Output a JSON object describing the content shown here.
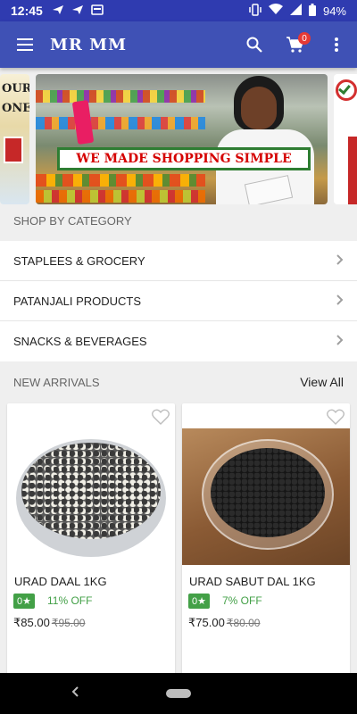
{
  "status_bar": {
    "time": "12:45",
    "battery": "94%",
    "icons": [
      "send-icon",
      "send-icon",
      "media-icon",
      "vibrate-icon",
      "wifi-icon",
      "signal-icon",
      "battery-icon"
    ]
  },
  "toolbar": {
    "title": "MR MM",
    "cart_count": "0",
    "icons": [
      "menu-icon",
      "search-icon",
      "cart-icon",
      "more-vert-icon"
    ],
    "color": "#3f51b5"
  },
  "banners": {
    "left_text_1": "OUR",
    "left_text_2": "ONE",
    "main_caption": "WE MADE SHOPPING SIMPLE"
  },
  "categories": {
    "header": "SHOP BY CATEGORY",
    "items": [
      {
        "label": "STAPLEES & GROCERY"
      },
      {
        "label": "PATANJALI PRODUCTS"
      },
      {
        "label": "SNACKS & BEVERAGES"
      }
    ]
  },
  "new_arrivals": {
    "header": "NEW ARRIVALS",
    "view_all": "View All",
    "products": [
      {
        "name": "URAD DAAL 1KG",
        "rating": "0★",
        "discount": "11% OFF",
        "price": "₹85.00",
        "mrp": "₹95.00"
      },
      {
        "name": "URAD SABUT DAL 1KG",
        "rating": "0★",
        "discount": "7% OFF",
        "price": "₹75.00",
        "mrp": "₹80.00"
      }
    ],
    "accent_color": "#43a047"
  }
}
